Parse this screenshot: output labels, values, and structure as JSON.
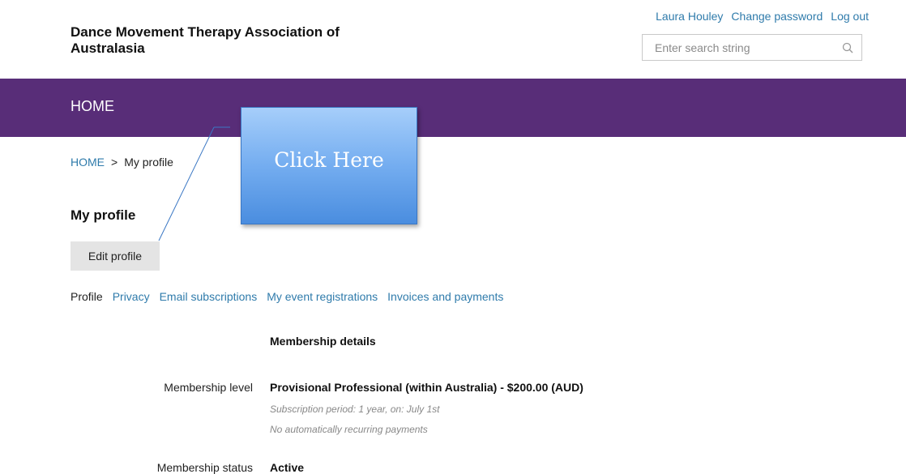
{
  "header": {
    "org_title": "Dance Movement Therapy Association of Australasia",
    "user_links": [
      "Laura Houley",
      "Change password",
      "Log out"
    ],
    "search_placeholder": "Enter search string",
    "search_icon": "magnifier"
  },
  "nav": {
    "home_label": "HOME",
    "background_color": "#582d78"
  },
  "breadcrumb": {
    "home": "HOME",
    "separator": ">",
    "current": "My profile"
  },
  "page": {
    "title": "My profile",
    "edit_button": "Edit profile"
  },
  "tabs": [
    {
      "label": "Profile",
      "active": true
    },
    {
      "label": "Privacy",
      "active": false
    },
    {
      "label": "Email subscriptions",
      "active": false
    },
    {
      "label": "My event registrations",
      "active": false
    },
    {
      "label": "Invoices and payments",
      "active": false
    }
  ],
  "membership": {
    "section_heading": "Membership details",
    "level_label": "Membership level",
    "level_value": "Provisional Professional (within Australia) - $200.00 (AUD)",
    "level_note_1": "Subscription period: 1 year, on: July 1st",
    "level_note_2": "No automatically recurring payments",
    "status_label": "Membership status",
    "status_value": "Active"
  },
  "callout": {
    "text": "Click Here"
  },
  "colors": {
    "link": "#2f7bab",
    "nav": "#582d78",
    "callout_top": "#a6cefa",
    "callout_bottom": "#4a8ddf"
  }
}
